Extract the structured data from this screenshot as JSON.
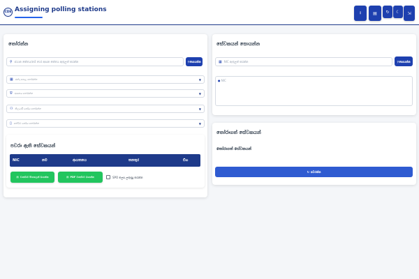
{
  "header": {
    "logo_text": "CDE",
    "title": "Assigning polling stations"
  },
  "toolbar": {
    "buttons": [
      {
        "icon": "download-icon",
        "glyph": "⭳"
      },
      {
        "icon": "document-icon",
        "glyph": "▤"
      },
      {
        "icon": "refresh-icon",
        "glyph": "↻"
      },
      {
        "icon": "moon-icon",
        "glyph": "☾"
      },
      {
        "icon": "logout-icon",
        "glyph": "⇲"
      }
    ]
  },
  "left_card": {
    "title": "තෝරන්න",
    "search_placeholder": "ස්ථාන කේතය/නම් හෝ ආසන කේතය ඇතුලත් කරන්න",
    "search_button": "සොයන්න",
    "selects": [
      {
        "icon": "building-icon",
        "glyph": "▦",
        "text": "ඡන්ද පොළ තෝරන්න"
      },
      {
        "icon": "shield-icon",
        "glyph": "⛨",
        "text": "ආසනය තෝරන්න"
      },
      {
        "icon": "users-icon",
        "glyph": "⚇",
        "text": "නිලධාරී වර්ගය තෝරන්න"
      },
      {
        "icon": "phone-icon",
        "glyph": "▯",
        "text": "පත්වීම් වර්ගය තෝරන්න"
      }
    ],
    "assigned_title": "පවරා ඇති සේවකයන්",
    "table_headers": [
      "NIC",
      "නම",
      "ආයතනය",
      "තනතුර",
      "ඩීග"
    ],
    "green_buttons": [
      "වාර්තාව සිංහලෙන් බාගන්න",
      "PDF වාර්තාව බාගන්න"
    ],
    "checkbox_label": "SPO ලෙස ලකුණු කරන්න"
  },
  "right_card": {
    "title": "සේවකයන් සොයන්න",
    "search_placeholder": "NIC ඇතුලත් කරන්න",
    "search_button": "සොයන්න",
    "textarea_placeholder": "NIC"
  },
  "selected_card": {
    "title": "තෝරාගත් සේවකයන්",
    "subtitle": "තෝරාගත් සේවකයන්",
    "assign_button": "පවරන්න"
  },
  "colors": {
    "primary": "#1e40af",
    "header_table": "#1e3a8a",
    "success": "#22c55e",
    "assign": "#2f5bd1"
  }
}
